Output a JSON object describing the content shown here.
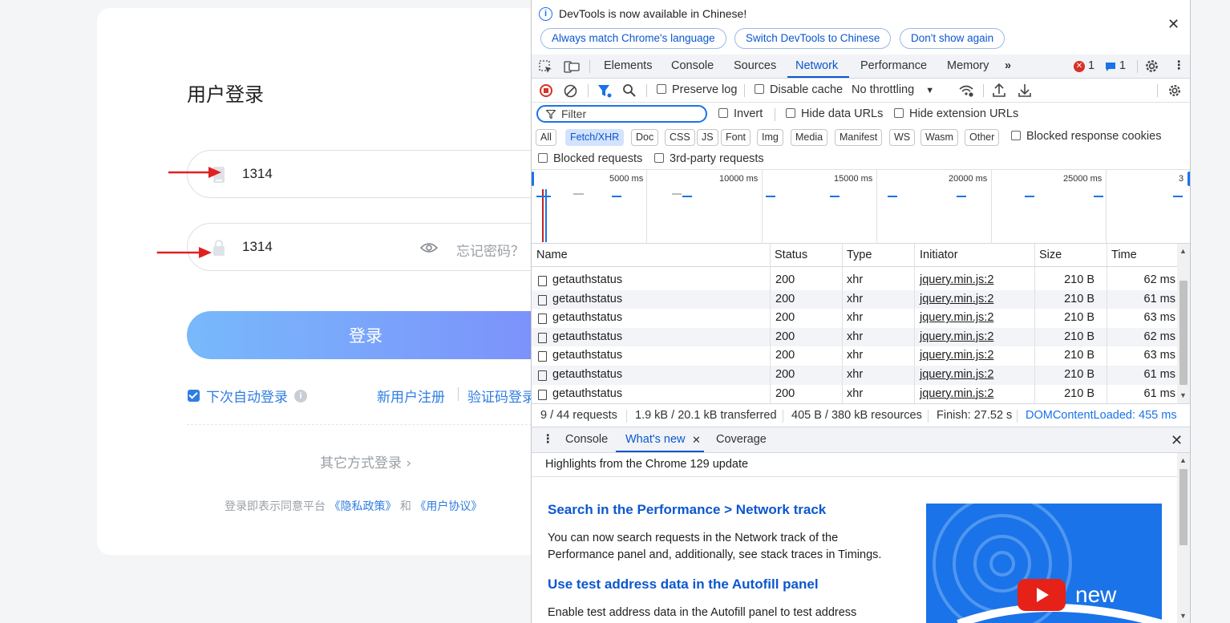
{
  "login": {
    "title": "用户登录",
    "username_value": "1314",
    "password_value": "1314",
    "forgot_label": "忘记密码？",
    "login_button": "登录",
    "auto_login_label": "下次自动登录",
    "register_link": "新用户注册",
    "sms_login_link": "验证码登录",
    "other_login": "其它方式登录",
    "agreement_prefix": "登录即表示同意平台",
    "privacy_link": "《隐私政策》",
    "agreement_and": "和",
    "user_agreement_link": "《用户协议》"
  },
  "devtools": {
    "infobar": {
      "message": "DevTools is now available in Chinese!",
      "btn_match": "Always match Chrome's language",
      "btn_switch": "Switch DevTools to Chinese",
      "btn_dismiss": "Don't show again"
    },
    "tabs": [
      "Elements",
      "Console",
      "Sources",
      "Network",
      "Performance",
      "Memory"
    ],
    "more_tabs": "»",
    "error_count": "1",
    "message_count": "1",
    "toolbar": {
      "preserve_log": "Preserve log",
      "disable_cache": "Disable cache",
      "throttling": "No throttling"
    },
    "filter": {
      "placeholder": "Filter",
      "invert": "Invert",
      "hide_data_urls": "Hide data URLs",
      "hide_extension_urls": "Hide extension URLs"
    },
    "type_filters": [
      "All",
      "Fetch/XHR",
      "Doc",
      "CSS",
      "JS",
      "Font",
      "Img",
      "Media",
      "Manifest",
      "WS",
      "Wasm",
      "Other"
    ],
    "active_type_filter": "Fetch/XHR",
    "blocked_response_cookies": "Blocked response cookies",
    "blocked_requests": "Blocked requests",
    "third_party_requests": "3rd-party requests",
    "timeline_labels": [
      "5000 ms",
      "10000 ms",
      "15000 ms",
      "20000 ms",
      "25000 ms",
      "3"
    ],
    "columns": [
      "Name",
      "Status",
      "Type",
      "Initiator",
      "Size",
      "Time"
    ],
    "rows": [
      {
        "name": "getauthstatus",
        "status": "200",
        "type": "xhr",
        "initiator": "jquery.min.js:2",
        "size": "210 B",
        "time": "62 ms"
      },
      {
        "name": "getauthstatus",
        "status": "200",
        "type": "xhr",
        "initiator": "jquery.min.js:2",
        "size": "210 B",
        "time": "61 ms"
      },
      {
        "name": "getauthstatus",
        "status": "200",
        "type": "xhr",
        "initiator": "jquery.min.js:2",
        "size": "210 B",
        "time": "63 ms"
      },
      {
        "name": "getauthstatus",
        "status": "200",
        "type": "xhr",
        "initiator": "jquery.min.js:2",
        "size": "210 B",
        "time": "62 ms"
      },
      {
        "name": "getauthstatus",
        "status": "200",
        "type": "xhr",
        "initiator": "jquery.min.js:2",
        "size": "210 B",
        "time": "63 ms"
      },
      {
        "name": "getauthstatus",
        "status": "200",
        "type": "xhr",
        "initiator": "jquery.min.js:2",
        "size": "210 B",
        "time": "61 ms"
      },
      {
        "name": "getauthstatus",
        "status": "200",
        "type": "xhr",
        "initiator": "jquery.min.js:2",
        "size": "210 B",
        "time": "61 ms"
      }
    ],
    "status_bar": {
      "requests": "9 / 44 requests",
      "transferred": "1.9 kB / 20.1 kB transferred",
      "resources": "405 B / 380 kB resources",
      "finish": "Finish: 27.52 s",
      "dom_loaded": "DOMContentLoaded: 455 ms"
    },
    "drawer": {
      "tabs": [
        "Console",
        "What's new",
        "Coverage"
      ],
      "highlights": "Highlights from the Chrome 129 update",
      "heading1": "Search in the Performance > Network track",
      "para1": "You can now search requests in the Network track of the Performance panel and, additionally, see stack traces in Timings.",
      "heading2": "Use test address data in the Autofill panel",
      "para2": "Enable test address data in the Autofill panel to test address",
      "promo_word": "new"
    },
    "colors": {
      "accent": "#0b57d0",
      "error": "#d93025",
      "login_gradient_start": "#78b9fb",
      "login_gradient_end": "#7d8afb"
    }
  }
}
